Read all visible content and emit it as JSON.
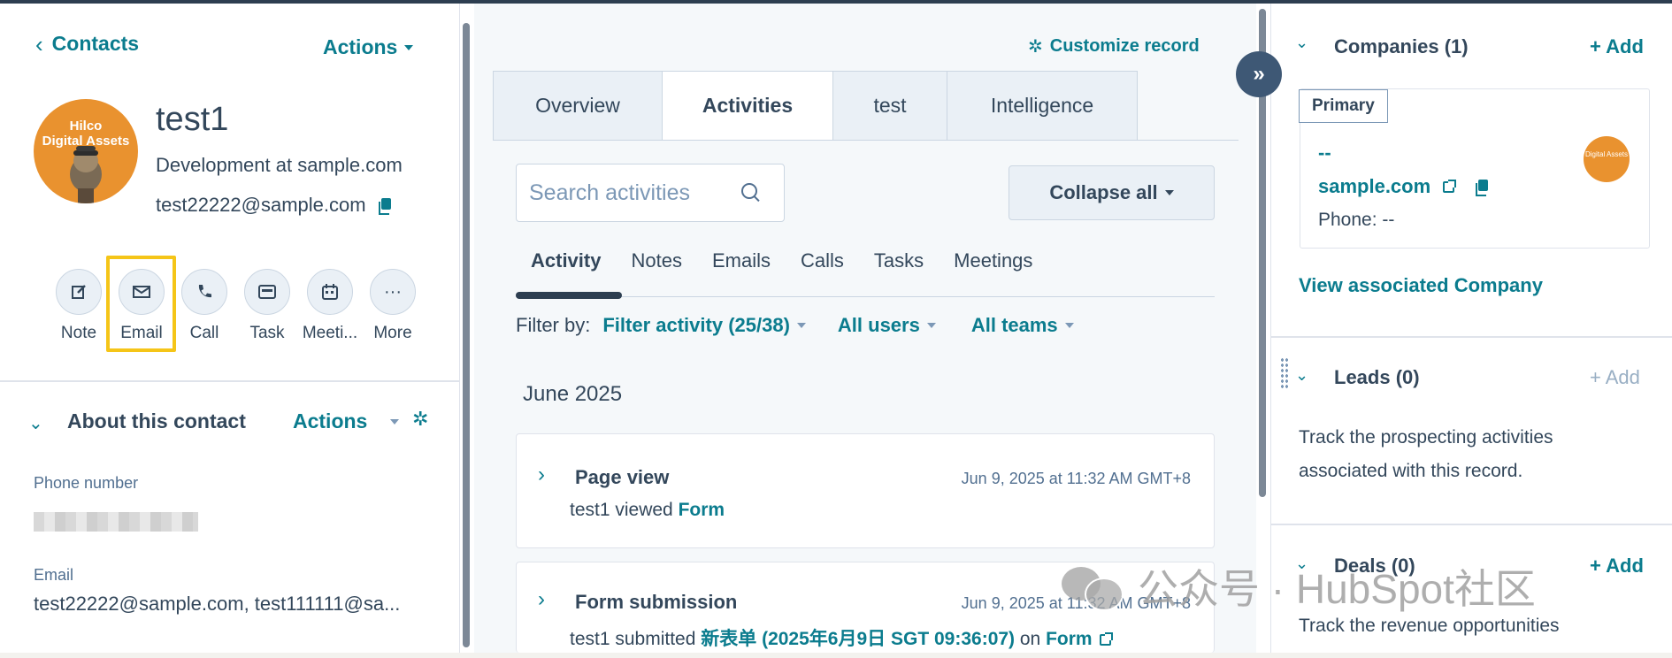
{
  "left": {
    "back_label": "Contacts",
    "actions_label": "Actions",
    "avatar_text_line1": "Hilco",
    "avatar_text_line2": "Digital Assets",
    "contact_name": "test1",
    "contact_subtitle": "Development at sample.com",
    "contact_email": "test22222@sample.com",
    "quick_actions": [
      {
        "label": "Note",
        "icon": "edit-icon"
      },
      {
        "label": "Email",
        "icon": "envelope-icon"
      },
      {
        "label": "Call",
        "icon": "phone-icon"
      },
      {
        "label": "Task",
        "icon": "task-icon"
      },
      {
        "label": "Meeti...",
        "icon": "calendar-icon"
      },
      {
        "label": "More",
        "icon": "ellipsis-icon"
      }
    ],
    "about_title": "About this contact",
    "about_actions_label": "Actions",
    "phone_label": "Phone number",
    "email_label": "Email",
    "email_value": "test22222@sample.com, test111111@sa..."
  },
  "middle": {
    "customize_label": "Customize record",
    "tabs": [
      "Overview",
      "Activities",
      "test",
      "Intelligence"
    ],
    "active_tab": "Activities",
    "search_placeholder": "Search activities",
    "collapse_label": "Collapse all",
    "activity_tabs": [
      "Activity",
      "Notes",
      "Emails",
      "Calls",
      "Tasks",
      "Meetings"
    ],
    "filter_by_label": "Filter by:",
    "filter_activity": "Filter activity (25/38)",
    "all_users": "All users",
    "all_teams": "All teams",
    "month": "June 2025",
    "activities": [
      {
        "title": "Page view",
        "time": "Jun 9, 2025 at 11:32 AM GMT+8",
        "body_prefix": "test1 viewed ",
        "body_link": "Form"
      },
      {
        "title": "Form submission",
        "time": "Jun 9, 2025 at 11:32 AM GMT+8",
        "body_prefix": "test1 submitted ",
        "body_link": "新表单 (2025年6月9日 SGT 09:36:07)",
        "body_mid": " on ",
        "body_link2": "Form"
      }
    ]
  },
  "right": {
    "companies_title": "Companies (1)",
    "add_label": "+ Add",
    "primary_badge": "Primary",
    "company_name": "--",
    "company_domain": "sample.com",
    "company_phone": "Phone: --",
    "view_company": "View associated Company",
    "leads_title": "Leads (0)",
    "leads_text_line1": "Track the prospecting activities",
    "leads_text_line2": "associated with this record.",
    "deals_title": "Deals (0)",
    "deals_text": "Track the revenue opportunities"
  },
  "watermark": {
    "text": "公众号 · HubSpot社区"
  },
  "colors": {
    "accent": "#0b7c8e",
    "text": "#33475b",
    "highlight": "#f5c518",
    "avatar": "#e9922f"
  }
}
